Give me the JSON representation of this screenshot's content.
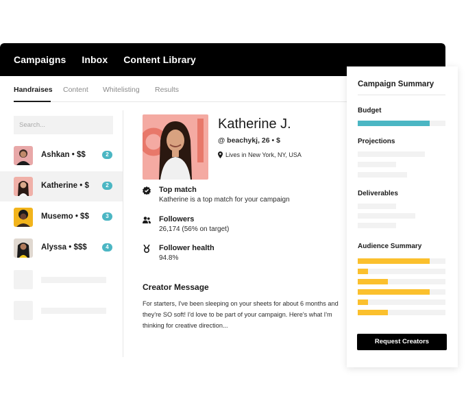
{
  "topnav": {
    "campaigns": "Campaigns",
    "inbox": "Inbox",
    "content_library": "Content Library"
  },
  "subtabs": {
    "handraises": "Handraises",
    "content": "Content",
    "whitelisting": "Whitelisting",
    "results": "Results"
  },
  "sidebar": {
    "search_placeholder": "Search...",
    "creators": [
      {
        "name": "Ashkan • $$",
        "count": "2"
      },
      {
        "name": "Katherine • $",
        "count": "2"
      },
      {
        "name": "Musemo • $$",
        "count": "3"
      },
      {
        "name": "Alyssa • $$$",
        "count": "4"
      }
    ]
  },
  "profile": {
    "name": "Katherine J.",
    "handle": "@ beachykj, 26 • $",
    "location": "Lives in New York, NY, USA"
  },
  "stats": {
    "top_match": {
      "title": "Top match",
      "value": "Katherine is a top match for your campaign"
    },
    "followers": {
      "title": "Followers",
      "value": "26,174 (56% on target)"
    },
    "health": {
      "title": "Follower health",
      "value": "94.8%"
    }
  },
  "message": {
    "title": "Creator Message",
    "body": "For starters, I've been sleeping on your sheets for about 6 months and they're SO soft! I'd love to be part of your campaign. Here's what I'm thinking for creative direction..."
  },
  "summary": {
    "title": "Campaign Summary",
    "budget_label": "Budget",
    "budget_fill": 0.82,
    "projections_label": "Projections",
    "deliverables_label": "Deliverables",
    "audience_label": "Audience Summary",
    "audience_fills": [
      0.82,
      0.12,
      0.34,
      0.82,
      0.12,
      0.34
    ],
    "cta": "Request Creators"
  },
  "colors": {
    "accent_teal": "#4bb6c3",
    "accent_yellow": "#fbc02d",
    "topbar": "#000000"
  }
}
